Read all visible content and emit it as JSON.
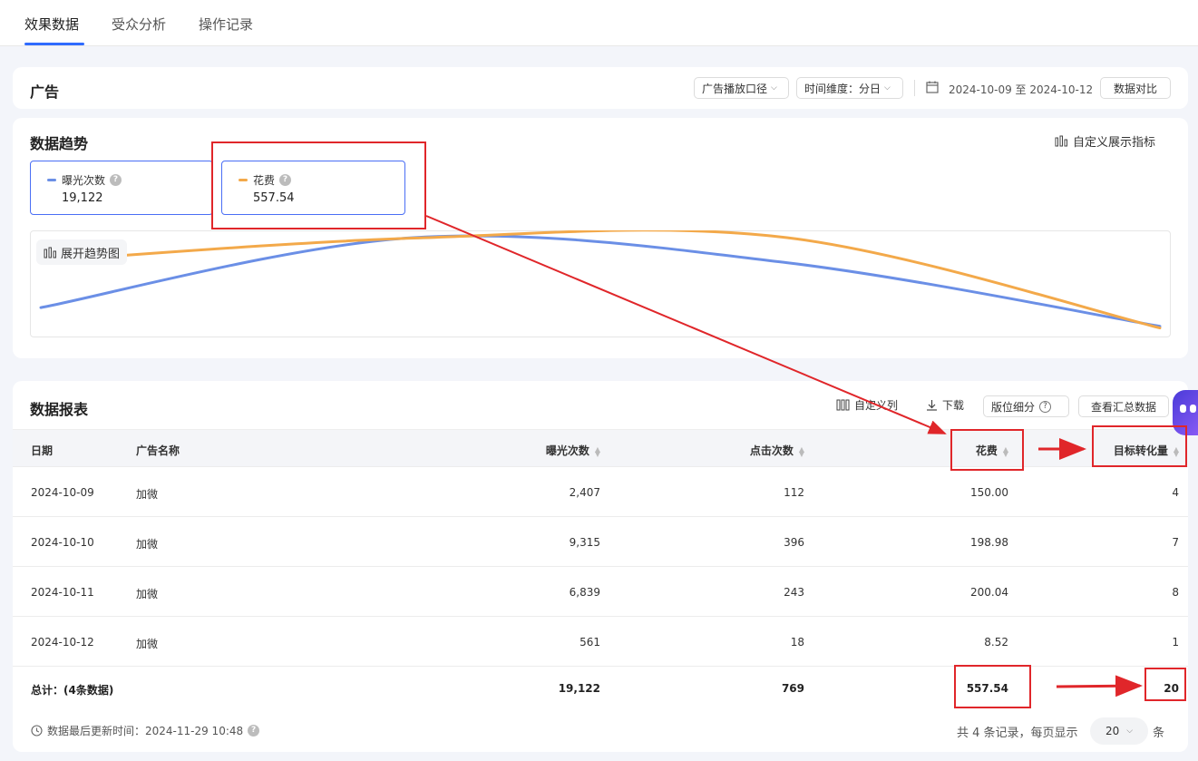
{
  "tabs": [
    {
      "label": "效果数据"
    },
    {
      "label": "受众分析"
    },
    {
      "label": "操作记录"
    }
  ],
  "ad_panel": {
    "title": "广告",
    "play_scope": "广告播放口径",
    "time_dim": "时间维度：分日",
    "date_range": "2024-10-09 至 2024-10-12",
    "compare": "数据对比"
  },
  "trend": {
    "title": "数据趋势",
    "custom_metrics": "自定义展示指标",
    "expand_label": "展开趋势图",
    "metrics": [
      {
        "label": "曝光次数",
        "value": "19,122",
        "color": "#6b8fe6"
      },
      {
        "label": "花费",
        "value": "557.54",
        "color": "#f3a94a"
      }
    ]
  },
  "chart_data": {
    "type": "line",
    "categories": [
      "2024-10-09",
      "2024-10-10",
      "2024-10-11",
      "2024-10-12"
    ],
    "series": [
      {
        "name": "曝光次数",
        "values": [
          2407,
          9315,
          6839,
          561
        ],
        "color": "#6b8fe6"
      },
      {
        "name": "花费",
        "values": [
          150.0,
          198.98,
          200.04,
          8.52
        ],
        "color": "#f3a94a"
      }
    ],
    "grid": false,
    "axes_visible": false
  },
  "report": {
    "title": "数据报表",
    "tools": {
      "custom_columns": "自定义列",
      "download": "下载",
      "placement": "版位细分",
      "summary": "查看汇总数据"
    },
    "columns": {
      "date": "日期",
      "ad_name": "广告名称",
      "impressions": "曝光次数",
      "clicks": "点击次数",
      "cost": "花费",
      "conversions": "目标转化量"
    },
    "rows": [
      {
        "date": "2024-10-09",
        "ad_name": "加微",
        "impressions": "2,407",
        "clicks": "112",
        "cost": "150.00",
        "conversions": "4"
      },
      {
        "date": "2024-10-10",
        "ad_name": "加微",
        "impressions": "9,315",
        "clicks": "396",
        "cost": "198.98",
        "conversions": "7"
      },
      {
        "date": "2024-10-11",
        "ad_name": "加微",
        "impressions": "6,839",
        "clicks": "243",
        "cost": "200.04",
        "conversions": "8"
      },
      {
        "date": "2024-10-12",
        "ad_name": "加微",
        "impressions": "561",
        "clicks": "18",
        "cost": "8.52",
        "conversions": "1"
      }
    ],
    "total": {
      "label": "总计：(4条数据)",
      "impressions": "19,122",
      "clicks": "769",
      "cost": "557.54",
      "conversions": "20"
    },
    "updated": "数据最后更新时间：2024-11-29 10:48",
    "records": "共 4 条记录，每页显示",
    "page_size": "20",
    "unit": "条"
  }
}
